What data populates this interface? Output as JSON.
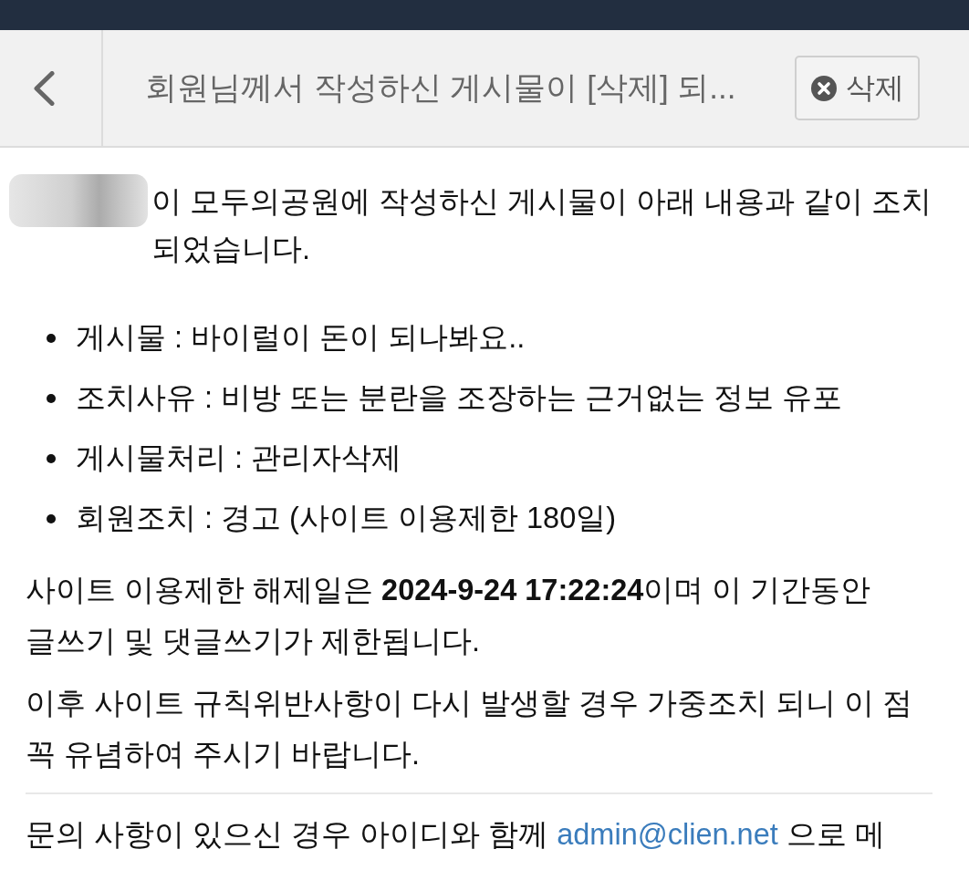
{
  "header": {
    "title": "회원님께서 작성하신 게시물이 [삭제] 되...",
    "delete_button": "삭제"
  },
  "intro": "이 모두의공원에 작성하신 게시물이 아래 내용과 같이 조치 되었습니다.",
  "details": [
    "게시물 : 바이럴이 돈이 되나봐요..",
    "조치사유 : 비방 또는 분란을 조장하는 근거없는 정보 유포",
    "게시물처리 : 관리자삭제",
    "회원조치 : 경고 (사이트 이용제한 180일)"
  ],
  "paragraphs": [
    "사이트 이용제한 해제일은 **2024-9-24 17:22:24**이며 이 기간동안 글쓰기 및 댓글쓰기가 제한됩니다.",
    "이후 사이트 규칙위반사항이 다시 발생할 경우 가중조치 되니 이 점 꼭 유념하여 주시기 바랍니다."
  ],
  "contact": {
    "text_before": "문의 사항이 있으신 경우 아이디와 함께",
    "link": "admin@clien.net",
    "text_after": "으로 메"
  }
}
